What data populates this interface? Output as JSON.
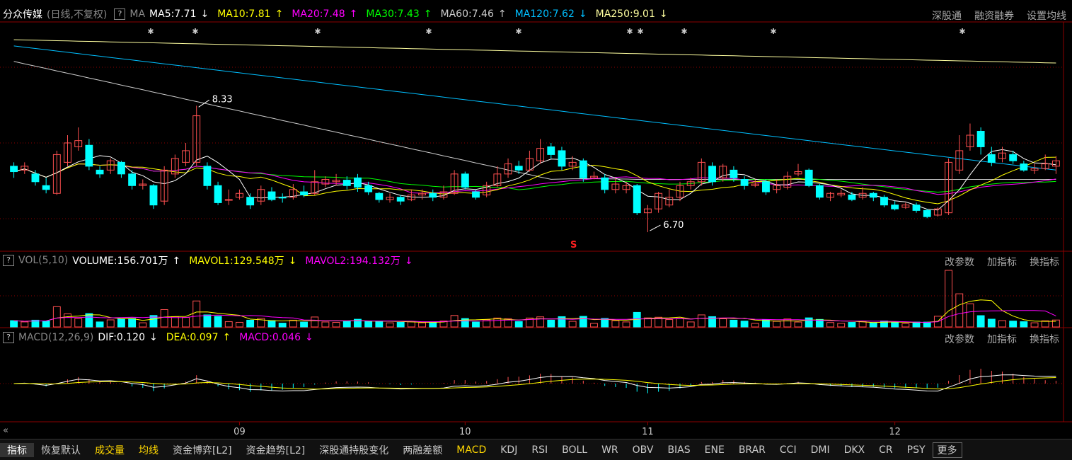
{
  "header": {
    "stock_name": "分众传媒",
    "period": "(日线,不复权)",
    "help": "?",
    "ma_label": "MA",
    "ma5": "MA5:7.71",
    "ma10": "MA10:7.81",
    "ma20": "MA20:7.48",
    "ma30": "MA30:7.43",
    "ma60": "MA60:7.46",
    "ma120": "MA120:7.62",
    "ma250": "MA250:9.01",
    "arr_down": "↓",
    "arr_up": "↑",
    "links": [
      "深股通",
      "融资融券",
      "设置均线"
    ]
  },
  "vol_header": {
    "label": "VOL(5,10)",
    "volume": "VOLUME:156.701万",
    "mavol1": "MAVOL1:129.548万",
    "mavol2": "MAVOL2:194.132万",
    "links": [
      "改参数",
      "加指标",
      "换指标"
    ]
  },
  "macd_header": {
    "label": "MACD(12,26,9)",
    "dif": "DIF:0.120",
    "dea": "DEA:0.097",
    "macd": "MACD:0.046",
    "links": [
      "改参数",
      "加指标",
      "换指标"
    ]
  },
  "colors": {
    "up": "#ff5050",
    "down": "#00ffff",
    "ma5": "#ffffff",
    "ma10": "#ffff00",
    "ma20": "#ff00ff",
    "ma30": "#00ff00",
    "ma60": "#cccccc",
    "ma120": "#00bfff",
    "ma250": "#ffffa0"
  },
  "chart_data": {
    "type": "candlestick",
    "price_range": [
      6.5,
      9.4
    ],
    "annotations": {
      "high": "8.33",
      "low": "6.70",
      "signal": "S"
    },
    "x_tick_labels": [
      {
        "label": "09",
        "index": 21
      },
      {
        "label": "10",
        "index": 42
      },
      {
        "label": "11",
        "index": 59
      },
      {
        "label": "12",
        "index": 82
      }
    ],
    "candles": [
      {
        "o": 7.55,
        "c": 7.48,
        "h": 7.6,
        "l": 7.4
      },
      {
        "o": 7.5,
        "c": 7.55,
        "h": 7.6,
        "l": 7.45
      },
      {
        "o": 7.45,
        "c": 7.35,
        "h": 7.5,
        "l": 7.3
      },
      {
        "o": 7.3,
        "c": 7.25,
        "h": 7.4,
        "l": 7.2
      },
      {
        "o": 7.2,
        "c": 7.7,
        "h": 7.75,
        "l": 7.18
      },
      {
        "o": 7.6,
        "c": 7.85,
        "h": 7.95,
        "l": 7.55
      },
      {
        "o": 7.8,
        "c": 7.88,
        "h": 8.05,
        "l": 7.75
      },
      {
        "o": 7.82,
        "c": 7.55,
        "h": 7.9,
        "l": 7.5
      },
      {
        "o": 7.5,
        "c": 7.45,
        "h": 7.55,
        "l": 7.4
      },
      {
        "o": 7.5,
        "c": 7.62,
        "h": 7.65,
        "l": 7.45
      },
      {
        "o": 7.6,
        "c": 7.45,
        "h": 7.62,
        "l": 7.4
      },
      {
        "o": 7.45,
        "c": 7.3,
        "h": 7.5,
        "l": 7.25
      },
      {
        "o": 7.3,
        "c": 7.32,
        "h": 7.38,
        "l": 7.25
      },
      {
        "o": 7.3,
        "c": 7.05,
        "h": 7.32,
        "l": 7.0
      },
      {
        "o": 7.1,
        "c": 7.5,
        "h": 7.55,
        "l": 7.05
      },
      {
        "o": 7.45,
        "c": 7.65,
        "h": 7.7,
        "l": 7.4
      },
      {
        "o": 7.6,
        "c": 7.75,
        "h": 7.85,
        "l": 7.55
      },
      {
        "o": 7.6,
        "c": 8.2,
        "h": 8.33,
        "l": 7.55
      },
      {
        "o": 7.55,
        "c": 7.3,
        "h": 7.6,
        "l": 7.25
      },
      {
        "o": 7.3,
        "c": 7.08,
        "h": 7.35,
        "l": 7.05
      },
      {
        "o": 7.12,
        "c": 7.12,
        "h": 7.25,
        "l": 7.05
      },
      {
        "o": 7.15,
        "c": 7.2,
        "h": 7.25,
        "l": 7.12
      },
      {
        "o": 7.15,
        "c": 7.05,
        "h": 7.2,
        "l": 7.0
      },
      {
        "o": 7.1,
        "c": 7.25,
        "h": 7.3,
        "l": 7.05
      },
      {
        "o": 7.22,
        "c": 7.12,
        "h": 7.28,
        "l": 7.1
      },
      {
        "o": 7.15,
        "c": 7.14,
        "h": 7.2,
        "l": 7.08
      },
      {
        "o": 7.15,
        "c": 7.25,
        "h": 7.32,
        "l": 7.12
      },
      {
        "o": 7.22,
        "c": 7.18,
        "h": 7.3,
        "l": 7.15
      },
      {
        "o": 7.2,
        "c": 7.35,
        "h": 7.5,
        "l": 7.18
      },
      {
        "o": 7.32,
        "c": 7.38,
        "h": 7.42,
        "l": 7.28
      },
      {
        "o": 7.35,
        "c": 7.37,
        "h": 7.45,
        "l": 7.3
      },
      {
        "o": 7.37,
        "c": 7.3,
        "h": 7.42,
        "l": 7.25
      },
      {
        "o": 7.4,
        "c": 7.28,
        "h": 7.45,
        "l": 7.22
      },
      {
        "o": 7.3,
        "c": 7.22,
        "h": 7.35,
        "l": 7.18
      },
      {
        "o": 7.2,
        "c": 7.12,
        "h": 7.22,
        "l": 7.08
      },
      {
        "o": 7.12,
        "c": 7.15,
        "h": 7.2,
        "l": 7.08
      },
      {
        "o": 7.15,
        "c": 7.1,
        "h": 7.18,
        "l": 7.05
      },
      {
        "o": 7.12,
        "c": 7.18,
        "h": 7.25,
        "l": 7.1
      },
      {
        "o": 7.18,
        "c": 7.2,
        "h": 7.25,
        "l": 7.12
      },
      {
        "o": 7.2,
        "c": 7.15,
        "h": 7.25,
        "l": 7.1
      },
      {
        "o": 7.15,
        "c": 7.22,
        "h": 7.3,
        "l": 7.12
      },
      {
        "o": 7.2,
        "c": 7.45,
        "h": 7.5,
        "l": 7.18
      },
      {
        "o": 7.45,
        "c": 7.28,
        "h": 7.48,
        "l": 7.25
      },
      {
        "o": 7.22,
        "c": 7.15,
        "h": 7.25,
        "l": 7.12
      },
      {
        "o": 7.18,
        "c": 7.3,
        "h": 7.35,
        "l": 7.15
      },
      {
        "o": 7.3,
        "c": 7.45,
        "h": 7.55,
        "l": 7.28
      },
      {
        "o": 7.45,
        "c": 7.58,
        "h": 7.65,
        "l": 7.4
      },
      {
        "o": 7.55,
        "c": 7.5,
        "h": 7.62,
        "l": 7.45
      },
      {
        "o": 7.5,
        "c": 7.65,
        "h": 7.75,
        "l": 7.48
      },
      {
        "o": 7.62,
        "c": 7.78,
        "h": 7.9,
        "l": 7.58
      },
      {
        "o": 7.8,
        "c": 7.7,
        "h": 7.85,
        "l": 7.65
      },
      {
        "o": 7.75,
        "c": 7.55,
        "h": 7.8,
        "l": 7.5
      },
      {
        "o": 7.55,
        "c": 7.6,
        "h": 7.68,
        "l": 7.5
      },
      {
        "o": 7.62,
        "c": 7.4,
        "h": 7.65,
        "l": 7.35
      },
      {
        "o": 7.4,
        "c": 7.42,
        "h": 7.48,
        "l": 7.38
      },
      {
        "o": 7.4,
        "c": 7.25,
        "h": 7.45,
        "l": 7.2
      },
      {
        "o": 7.25,
        "c": 7.32,
        "h": 7.4,
        "l": 7.2
      },
      {
        "o": 7.25,
        "c": 7.3,
        "h": 7.35,
        "l": 7.2
      },
      {
        "o": 7.3,
        "c": 6.95,
        "h": 7.32,
        "l": 6.92
      },
      {
        "o": 6.95,
        "c": 7.0,
        "h": 7.05,
        "l": 6.7
      },
      {
        "o": 7.0,
        "c": 7.2,
        "h": 7.22,
        "l": 6.95
      },
      {
        "o": 7.05,
        "c": 7.15,
        "h": 7.25,
        "l": 7.02
      },
      {
        "o": 7.15,
        "c": 7.3,
        "h": 7.35,
        "l": 7.1
      },
      {
        "o": 7.3,
        "c": 7.35,
        "h": 7.4,
        "l": 7.25
      },
      {
        "o": 7.35,
        "c": 7.6,
        "h": 7.65,
        "l": 7.3
      },
      {
        "o": 7.55,
        "c": 7.35,
        "h": 7.6,
        "l": 7.3
      },
      {
        "o": 7.4,
        "c": 7.55,
        "h": 7.58,
        "l": 7.35
      },
      {
        "o": 7.5,
        "c": 7.4,
        "h": 7.55,
        "l": 7.35
      },
      {
        "o": 7.38,
        "c": 7.3,
        "h": 7.42,
        "l": 7.25
      },
      {
        "o": 7.3,
        "c": 7.32,
        "h": 7.38,
        "l": 7.28
      },
      {
        "o": 7.35,
        "c": 7.22,
        "h": 7.38,
        "l": 7.18
      },
      {
        "o": 7.25,
        "c": 7.3,
        "h": 7.38,
        "l": 7.2
      },
      {
        "o": 7.28,
        "c": 7.42,
        "h": 7.48,
        "l": 7.25
      },
      {
        "o": 7.45,
        "c": 7.48,
        "h": 7.58,
        "l": 7.42
      },
      {
        "o": 7.5,
        "c": 7.3,
        "h": 7.52,
        "l": 7.28
      },
      {
        "o": 7.3,
        "c": 7.15,
        "h": 7.32,
        "l": 7.12
      },
      {
        "o": 7.15,
        "c": 7.2,
        "h": 7.22,
        "l": 7.1
      },
      {
        "o": 7.18,
        "c": 7.2,
        "h": 7.25,
        "l": 7.15
      },
      {
        "o": 7.18,
        "c": 7.12,
        "h": 7.22,
        "l": 7.1
      },
      {
        "o": 7.15,
        "c": 7.2,
        "h": 7.28,
        "l": 7.12
      },
      {
        "o": 7.2,
        "c": 7.15,
        "h": 7.22,
        "l": 7.1
      },
      {
        "o": 7.15,
        "c": 7.05,
        "h": 7.18,
        "l": 7.02
      },
      {
        "o": 7.05,
        "c": 7.0,
        "h": 7.1,
        "l": 6.98
      },
      {
        "o": 7.02,
        "c": 7.05,
        "h": 7.08,
        "l": 7.0
      },
      {
        "o": 7.05,
        "c": 6.98,
        "h": 7.08,
        "l": 6.95
      },
      {
        "o": 6.98,
        "c": 6.9,
        "h": 7.0,
        "l": 6.88
      },
      {
        "o": 6.92,
        "c": 7.0,
        "h": 7.02,
        "l": 6.9
      },
      {
        "o": 6.95,
        "c": 7.6,
        "h": 7.65,
        "l": 6.92
      },
      {
        "o": 7.5,
        "c": 7.75,
        "h": 7.95,
        "l": 7.45
      },
      {
        "o": 7.8,
        "c": 7.95,
        "h": 8.1,
        "l": 7.75
      },
      {
        "o": 8.0,
        "c": 7.8,
        "h": 8.05,
        "l": 7.7
      },
      {
        "o": 7.7,
        "c": 7.6,
        "h": 7.8,
        "l": 7.55
      },
      {
        "o": 7.65,
        "c": 7.72,
        "h": 7.8,
        "l": 7.6
      },
      {
        "o": 7.7,
        "c": 7.62,
        "h": 7.75,
        "l": 7.58
      },
      {
        "o": 7.58,
        "c": 7.5,
        "h": 7.62,
        "l": 7.48
      },
      {
        "o": 7.5,
        "c": 7.52,
        "h": 7.58,
        "l": 7.45
      },
      {
        "o": 7.52,
        "c": 7.58,
        "h": 7.7,
        "l": 7.5
      },
      {
        "o": 7.55,
        "c": 7.62,
        "h": 7.68,
        "l": 7.45
      }
    ],
    "ma_labels": [
      "MA5",
      "MA10",
      "MA20",
      "MA30",
      "MA60",
      "MA120",
      "MA250"
    ],
    "ma120_range": [
      9.1,
      7.5
    ],
    "ma250_range": [
      9.18,
      8.88
    ],
    "ma60_range": [
      8.9,
      7.38
    ]
  }
}
